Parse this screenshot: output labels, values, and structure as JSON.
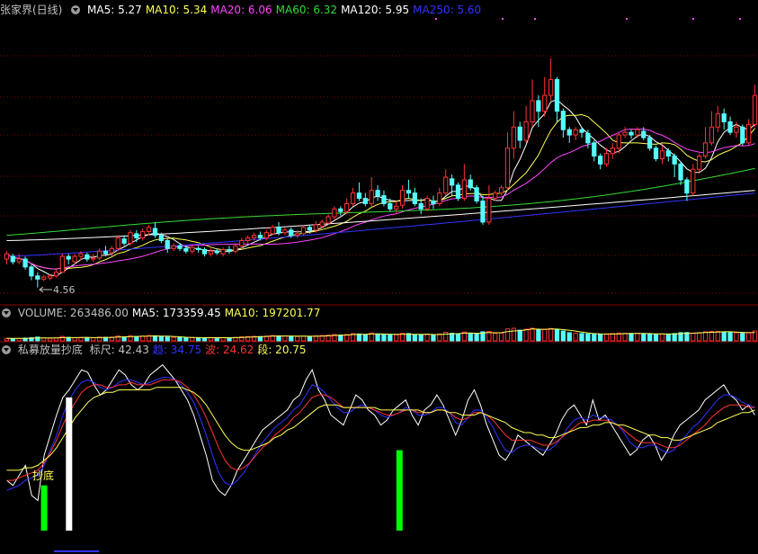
{
  "price_panel": {
    "title": "张家界(日线)",
    "indicators": [
      {
        "label": "MA5: 5.27",
        "color": "#ffffff"
      },
      {
        "label": "MA10: 5.34",
        "color": "#ffff55"
      },
      {
        "label": "MA20: 6.06",
        "color": "#ff44ff"
      },
      {
        "label": "MA60: 6.32",
        "color": "#33dd33"
      },
      {
        "label": "MA120: 5.95",
        "color": "#ffffff"
      },
      {
        "label": "MA250: 5.60",
        "color": "#3333ff"
      }
    ],
    "low_marker": "4.56"
  },
  "volume_panel": {
    "indicators": [
      {
        "label": "VOLUME: 263486.00",
        "color": "#c0c0c0"
      },
      {
        "label": "MA5: 173359.45",
        "color": "#ffffff"
      },
      {
        "label": "MA10: 197201.77",
        "color": "#ffff55"
      }
    ]
  },
  "indicator_panel": {
    "title": "私募放量抄底",
    "indicators": [
      {
        "label": "标尺: 42.43",
        "color": "#c0c0c0"
      },
      {
        "label": "趋: 34.75",
        "color": "#3333ff"
      },
      {
        "label": "波: 24.62",
        "color": "#ff3333"
      },
      {
        "label": "段: 20.75",
        "color": "#ffff55"
      }
    ],
    "signal_text": "抄底"
  },
  "colors": {
    "up": "#ff3333",
    "down": "#54ffff",
    "grid": "#8a0000",
    "ma5": "#ffffff",
    "ma10": "#ffff55",
    "ma20": "#ff44ff",
    "ma60": "#33dd33",
    "ma120": "#ffffff",
    "ma250": "#3333ff"
  },
  "chart_data": {
    "type": "candlestick",
    "ylim": [
      4.3,
      9.7
    ],
    "candles": [
      [
        5.1,
        5.2,
        5.25,
        5.0
      ],
      [
        5.15,
        5.05,
        5.2,
        5.0
      ],
      [
        5.05,
        5.1,
        5.2,
        5.0
      ],
      [
        5.1,
        4.95,
        5.15,
        4.9
      ],
      [
        4.95,
        4.78,
        5.0,
        4.7
      ],
      [
        4.78,
        4.72,
        4.85,
        4.56
      ],
      [
        4.72,
        4.76,
        4.8,
        4.68
      ],
      [
        4.74,
        4.78,
        4.82,
        4.7
      ],
      [
        4.78,
        4.85,
        4.9,
        4.75
      ],
      [
        4.85,
        5.15,
        5.2,
        4.85
      ],
      [
        5.15,
        5.1,
        5.2,
        5.0
      ],
      [
        5.05,
        5.15,
        5.2,
        5.0
      ],
      [
        5.15,
        5.2,
        5.25,
        5.08
      ],
      [
        5.18,
        5.1,
        5.22,
        5.05
      ],
      [
        5.1,
        5.12,
        5.2,
        5.05
      ],
      [
        5.12,
        5.25,
        5.3,
        5.08
      ],
      [
        5.25,
        5.2,
        5.35,
        5.15
      ],
      [
        5.22,
        5.3,
        5.35,
        5.15
      ],
      [
        5.3,
        5.5,
        5.55,
        5.25
      ],
      [
        5.48,
        5.4,
        5.55,
        5.35
      ],
      [
        5.4,
        5.6,
        5.65,
        5.35
      ],
      [
        5.58,
        5.5,
        5.65,
        5.42
      ],
      [
        5.5,
        5.62,
        5.68,
        5.45
      ],
      [
        5.62,
        5.7,
        5.75,
        5.55
      ],
      [
        5.68,
        5.55,
        5.8,
        5.5
      ],
      [
        5.55,
        5.45,
        5.6,
        5.4
      ],
      [
        5.45,
        5.3,
        5.5,
        5.22
      ],
      [
        5.3,
        5.35,
        5.4,
        5.25
      ],
      [
        5.35,
        5.3,
        5.4,
        5.25
      ],
      [
        5.3,
        5.25,
        5.35,
        5.2
      ],
      [
        5.25,
        5.32,
        5.38,
        5.2
      ],
      [
        5.3,
        5.28,
        5.35,
        5.22
      ],
      [
        5.28,
        5.2,
        5.32,
        5.15
      ],
      [
        5.2,
        5.25,
        5.3,
        5.15
      ],
      [
        5.25,
        5.22,
        5.3,
        5.18
      ],
      [
        5.2,
        5.28,
        5.32,
        5.15
      ],
      [
        5.28,
        5.25,
        5.35,
        5.2
      ],
      [
        5.25,
        5.35,
        5.4,
        5.2
      ],
      [
        5.35,
        5.45,
        5.5,
        5.3
      ],
      [
        5.45,
        5.5,
        5.55,
        5.4
      ],
      [
        5.5,
        5.55,
        5.6,
        5.45
      ],
      [
        5.55,
        5.5,
        5.62,
        5.45
      ],
      [
        5.5,
        5.6,
        5.65,
        5.45
      ],
      [
        5.58,
        5.7,
        5.75,
        5.55
      ],
      [
        5.7,
        5.6,
        5.8,
        5.55
      ],
      [
        5.6,
        5.65,
        5.7,
        5.55
      ],
      [
        5.65,
        5.55,
        5.7,
        5.5
      ],
      [
        5.55,
        5.58,
        5.65,
        5.5
      ],
      [
        5.58,
        5.7,
        5.75,
        5.55
      ],
      [
        5.7,
        5.65,
        5.75,
        5.58
      ],
      [
        5.65,
        5.75,
        5.82,
        5.6
      ],
      [
        5.72,
        5.8,
        5.85,
        5.68
      ],
      [
        5.78,
        5.9,
        5.95,
        5.75
      ],
      [
        5.9,
        6.05,
        6.1,
        5.85
      ],
      [
        6.05,
        6.0,
        6.1,
        5.92
      ],
      [
        6.0,
        6.15,
        6.25,
        5.95
      ],
      [
        6.15,
        6.35,
        6.45,
        6.1
      ],
      [
        6.35,
        6.25,
        6.55,
        6.2
      ],
      [
        6.25,
        6.15,
        6.35,
        6.1
      ],
      [
        6.15,
        6.4,
        6.65,
        6.1
      ],
      [
        6.4,
        6.3,
        6.5,
        6.2
      ],
      [
        6.3,
        6.15,
        6.4,
        6.1
      ],
      [
        6.15,
        6.05,
        6.25,
        6.0
      ],
      [
        6.05,
        6.1,
        6.2,
        5.95
      ],
      [
        6.12,
        6.4,
        6.5,
        6.05
      ],
      [
        6.4,
        6.35,
        6.6,
        6.25
      ],
      [
        6.35,
        6.15,
        6.45,
        6.1
      ],
      [
        6.15,
        6.05,
        6.25,
        5.95
      ],
      [
        6.05,
        6.25,
        6.3,
        6.0
      ],
      [
        6.2,
        6.15,
        6.3,
        6.05
      ],
      [
        6.15,
        6.35,
        6.45,
        6.1
      ],
      [
        6.35,
        6.65,
        6.8,
        6.3
      ],
      [
        6.62,
        6.5,
        6.7,
        6.3
      ],
      [
        6.5,
        6.25,
        6.55,
        6.2
      ],
      [
        6.25,
        6.6,
        6.9,
        6.2
      ],
      [
        6.6,
        6.45,
        6.7,
        6.4
      ],
      [
        6.45,
        6.2,
        6.5,
        6.15
      ],
      [
        6.2,
        5.8,
        6.3,
        5.75
      ],
      [
        5.8,
        6.25,
        6.5,
        5.75
      ],
      [
        6.25,
        6.35,
        6.4,
        6.2
      ],
      [
        6.35,
        6.45,
        6.5,
        6.3
      ],
      [
        6.45,
        7.2,
        7.5,
        6.4
      ],
      [
        7.2,
        7.6,
        7.9,
        7.0
      ],
      [
        7.6,
        7.35,
        7.7,
        7.2
      ],
      [
        7.35,
        7.7,
        8.0,
        7.3
      ],
      [
        7.7,
        8.1,
        8.5,
        7.6
      ],
      [
        8.1,
        7.9,
        8.2,
        7.6
      ],
      [
        7.9,
        8.2,
        8.55,
        7.8
      ],
      [
        8.2,
        8.5,
        8.9,
        8.1
      ],
      [
        8.5,
        7.9,
        8.55,
        7.7
      ],
      [
        7.9,
        7.55,
        7.95,
        7.4
      ],
      [
        7.55,
        7.45,
        7.6,
        7.3
      ],
      [
        7.45,
        7.55,
        7.6,
        7.35
      ],
      [
        7.55,
        7.5,
        7.6,
        7.4
      ],
      [
        7.48,
        7.3,
        7.55,
        7.2
      ],
      [
        7.3,
        7.05,
        7.35,
        6.95
      ],
      [
        7.05,
        6.9,
        7.1,
        6.8
      ],
      [
        6.9,
        7.1,
        7.2,
        6.85
      ],
      [
        7.1,
        7.2,
        7.3,
        7.0
      ],
      [
        7.2,
        7.45,
        7.5,
        7.1
      ],
      [
        7.45,
        7.5,
        7.6,
        7.4
      ],
      [
        7.5,
        7.45,
        7.55,
        7.38
      ],
      [
        7.45,
        7.55,
        7.6,
        7.4
      ],
      [
        7.52,
        7.4,
        7.6,
        7.35
      ],
      [
        7.4,
        7.2,
        7.45,
        7.15
      ],
      [
        7.2,
        7.0,
        7.25,
        6.95
      ],
      [
        7.0,
        7.15,
        7.25,
        6.9
      ],
      [
        7.15,
        7.05,
        7.2,
        6.95
      ],
      [
        7.05,
        6.9,
        7.1,
        6.65
      ],
      [
        6.9,
        6.6,
        6.95,
        6.5
      ],
      [
        6.6,
        6.35,
        6.65,
        6.2
      ],
      [
        6.35,
        6.8,
        6.9,
        6.3
      ],
      [
        6.8,
        7.05,
        7.1,
        6.75
      ],
      [
        7.05,
        7.3,
        7.6,
        7.0
      ],
      [
        7.3,
        7.6,
        7.9,
        7.25
      ],
      [
        7.6,
        7.85,
        8.0,
        7.5
      ],
      [
        7.85,
        7.7,
        7.95,
        7.55
      ],
      [
        7.7,
        7.5,
        7.8,
        7.45
      ],
      [
        7.5,
        7.6,
        7.7,
        7.4
      ],
      [
        7.6,
        7.3,
        7.65,
        7.25
      ],
      [
        7.3,
        7.65,
        7.75,
        7.25
      ],
      [
        7.65,
        8.2,
        8.4,
        7.6
      ]
    ],
    "volume": [
      0.2,
      0.18,
      0.2,
      0.22,
      0.25,
      0.3,
      0.22,
      0.2,
      0.22,
      0.35,
      0.28,
      0.25,
      0.26,
      0.24,
      0.25,
      0.3,
      0.28,
      0.3,
      0.38,
      0.32,
      0.4,
      0.35,
      0.38,
      0.42,
      0.4,
      0.35,
      0.3,
      0.28,
      0.26,
      0.25,
      0.26,
      0.25,
      0.24,
      0.25,
      0.24,
      0.26,
      0.25,
      0.28,
      0.32,
      0.34,
      0.36,
      0.34,
      0.38,
      0.42,
      0.4,
      0.38,
      0.35,
      0.34,
      0.38,
      0.36,
      0.4,
      0.42,
      0.45,
      0.5,
      0.46,
      0.5,
      0.58,
      0.55,
      0.5,
      0.62,
      0.55,
      0.5,
      0.46,
      0.48,
      0.6,
      0.58,
      0.5,
      0.46,
      0.52,
      0.48,
      0.55,
      0.68,
      0.6,
      0.55,
      0.7,
      0.6,
      0.55,
      0.72,
      0.75,
      0.6,
      0.62,
      0.95,
      1.0,
      0.85,
      0.92,
      1.0,
      0.88,
      0.92,
      0.98,
      0.9,
      0.78,
      0.65,
      0.6,
      0.58,
      0.55,
      0.52,
      0.5,
      0.55,
      0.58,
      0.62,
      0.6,
      0.58,
      0.6,
      0.56,
      0.54,
      0.52,
      0.56,
      0.54,
      0.58,
      0.65,
      0.66,
      0.62,
      0.66,
      0.72,
      0.75,
      0.76,
      0.7,
      0.66,
      0.64,
      0.6,
      0.64,
      0.78
    ],
    "indicator": {
      "ylim": [
        -8,
        60
      ],
      "white": [
        12,
        10,
        14,
        18,
        6,
        4,
        22,
        30,
        38,
        45,
        48,
        52,
        56,
        55,
        50,
        46,
        48,
        52,
        56,
        54,
        50,
        48,
        50,
        54,
        56,
        58,
        55,
        52,
        48,
        44,
        38,
        30,
        22,
        12,
        8,
        6,
        10,
        16,
        20,
        24,
        28,
        32,
        34,
        36,
        38,
        40,
        44,
        46,
        52,
        56,
        48,
        44,
        38,
        36,
        34,
        40,
        46,
        44,
        40,
        38,
        34,
        36,
        40,
        42,
        44,
        38,
        34,
        40,
        42,
        46,
        42,
        36,
        30,
        36,
        44,
        48,
        42,
        34,
        28,
        22,
        20,
        24,
        30,
        28,
        26,
        24,
        22,
        26,
        30,
        36,
        40,
        42,
        38,
        34,
        44,
        36,
        38,
        34,
        30,
        26,
        22,
        24,
        28,
        30,
        26,
        20,
        24,
        30,
        34,
        36,
        38,
        40,
        44,
        46,
        48,
        50,
        46,
        44,
        40,
        42,
        38
      ],
      "blue": [
        8,
        9,
        10,
        12,
        13,
        14,
        18,
        24,
        30,
        38,
        44,
        48,
        51,
        52,
        51,
        49,
        48,
        49,
        51,
        52,
        52,
        51,
        50,
        51,
        52,
        53,
        53,
        52,
        50,
        47,
        43,
        37,
        30,
        22,
        15,
        11,
        10,
        12,
        15,
        19,
        23,
        27,
        30,
        33,
        35,
        37,
        40,
        42,
        46,
        50,
        49,
        47,
        44,
        41,
        39,
        39,
        41,
        42,
        41,
        40,
        38,
        37,
        38,
        39,
        41,
        40,
        38,
        38,
        39,
        41,
        41,
        39,
        35,
        34,
        37,
        40,
        40,
        37,
        33,
        28,
        24,
        23,
        25,
        26,
        26,
        25,
        24,
        24,
        26,
        29,
        33,
        36,
        37,
        36,
        38,
        37,
        37,
        36,
        34,
        31,
        27,
        25,
        25,
        26,
        26,
        24,
        23,
        24,
        27,
        30,
        33,
        35,
        38,
        41,
        44,
        46,
        46,
        45,
        43,
        42,
        41
      ],
      "red": [
        12,
        12,
        13,
        14,
        15,
        16,
        19,
        23,
        28,
        34,
        39,
        43,
        47,
        49,
        50,
        50,
        49,
        49,
        50,
        50,
        51,
        50,
        50,
        50,
        51,
        52,
        52,
        52,
        51,
        49,
        46,
        42,
        37,
        31,
        25,
        20,
        17,
        16,
        17,
        19,
        22,
        25,
        27,
        30,
        32,
        34,
        37,
        39,
        42,
        45,
        46,
        46,
        45,
        43,
        41,
        41,
        41,
        41,
        41,
        40,
        39,
        38,
        38,
        39,
        40,
        40,
        39,
        39,
        39,
        40,
        40,
        39,
        37,
        36,
        37,
        39,
        39,
        38,
        36,
        33,
        30,
        28,
        28,
        28,
        28,
        27,
        26,
        26,
        27,
        29,
        31,
        33,
        35,
        35,
        36,
        36,
        36,
        35,
        34,
        32,
        30,
        28,
        27,
        27,
        27,
        26,
        25,
        25,
        26,
        28,
        30,
        32,
        34,
        37,
        39,
        41,
        42,
        42,
        42,
        41,
        41
      ],
      "yellow": [
        16,
        16,
        16,
        17,
        17,
        18,
        20,
        22,
        25,
        29,
        33,
        37,
        40,
        43,
        45,
        46,
        47,
        47,
        48,
        48,
        48,
        48,
        48,
        48,
        49,
        49,
        49,
        49,
        49,
        48,
        47,
        45,
        42,
        38,
        34,
        30,
        27,
        25,
        24,
        24,
        25,
        26,
        27,
        29,
        30,
        32,
        33,
        35,
        37,
        39,
        41,
        42,
        42,
        42,
        41,
        41,
        41,
        41,
        41,
        41,
        40,
        40,
        40,
        40,
        40,
        40,
        40,
        39,
        39,
        40,
        40,
        39,
        39,
        38,
        38,
        38,
        39,
        38,
        37,
        36,
        35,
        33,
        32,
        31,
        31,
        30,
        30,
        29,
        29,
        30,
        31,
        32,
        33,
        33,
        34,
        34,
        35,
        35,
        34,
        34,
        33,
        32,
        31,
        30,
        30,
        29,
        29,
        28,
        28,
        29,
        30,
        31,
        32,
        33,
        35,
        36,
        37,
        38,
        39,
        39,
        40
      ],
      "signals": [
        {
          "x": 6,
          "type": "green",
          "value": 10
        },
        {
          "x": 10,
          "type": "white",
          "value": 45
        },
        {
          "x": 63,
          "type": "green",
          "value": 24
        }
      ]
    }
  }
}
